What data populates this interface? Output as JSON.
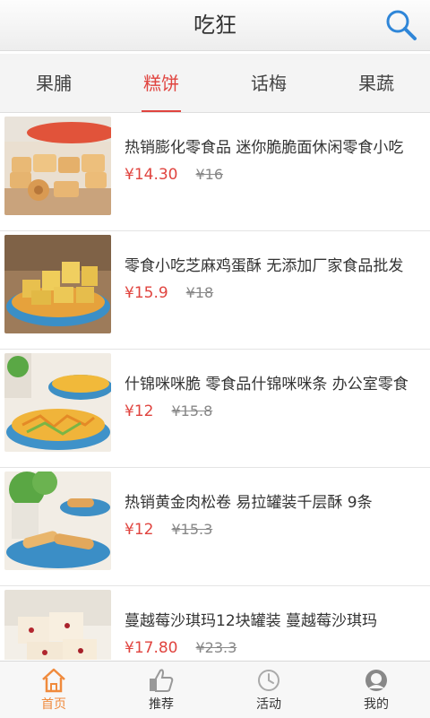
{
  "header": {
    "title": "吃狂",
    "search_icon": "search-icon"
  },
  "tabs": [
    {
      "label": "果脯",
      "active": false
    },
    {
      "label": "糕饼",
      "active": true
    },
    {
      "label": "话梅",
      "active": false
    },
    {
      "label": "果蔬",
      "active": false
    }
  ],
  "products": [
    {
      "name": "热销膨化零食品 迷你脆脆面休闲零食小吃",
      "price": "¥14.30",
      "old_price": "¥16"
    },
    {
      "name": "零食小吃芝麻鸡蛋酥 无添加厂家食品批发",
      "price": "¥15.9",
      "old_price": "¥18"
    },
    {
      "name": "什锦咪咪脆 零食品什锦咪咪条 办公室零食",
      "price": "¥12",
      "old_price": "¥15.8"
    },
    {
      "name": "热销黄金肉松卷 易拉罐装千层酥 9条",
      "price": "¥12",
      "old_price": "¥15.3"
    },
    {
      "name": "蔓越莓沙琪玛12块罐装 蔓越莓沙琪玛",
      "price": "¥17.80",
      "old_price": "¥23.3"
    }
  ],
  "bottom_nav": [
    {
      "label": "首页",
      "icon": "home-icon",
      "active": true
    },
    {
      "label": "推荐",
      "icon": "thumbs-up-icon",
      "active": false
    },
    {
      "label": "活动",
      "icon": "clock-icon",
      "active": false
    },
    {
      "label": "我的",
      "icon": "user-icon",
      "active": false
    }
  ],
  "colors": {
    "accent": "#e0443f",
    "nav_active": "#f08a3c"
  }
}
